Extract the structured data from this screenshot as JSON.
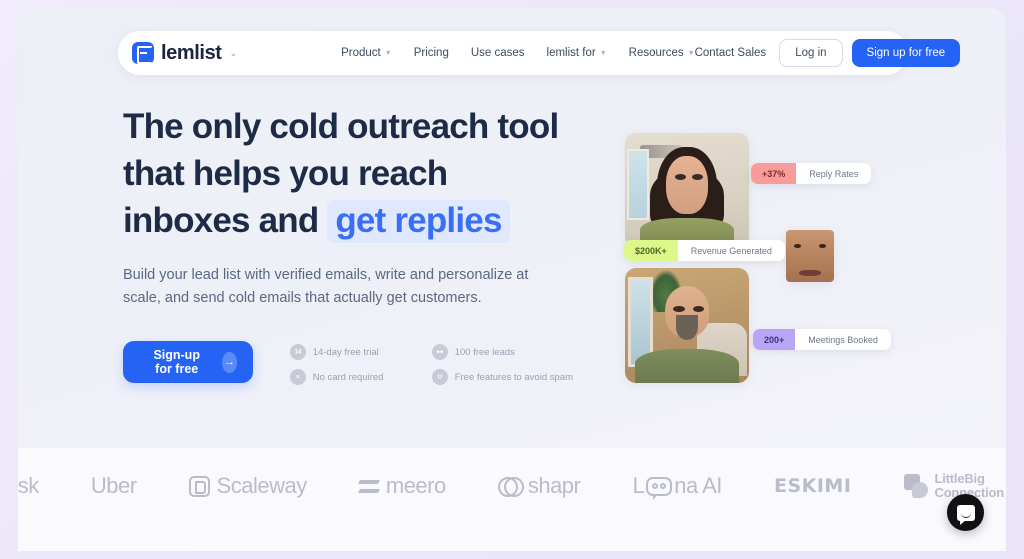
{
  "nav": {
    "brand": "lemlist",
    "brand_caret": "⌄",
    "links": [
      {
        "label": "Product",
        "has_caret": true
      },
      {
        "label": "Pricing",
        "has_caret": false
      },
      {
        "label": "Use cases",
        "has_caret": false
      },
      {
        "label": "lemlist for",
        "has_caret": true
      },
      {
        "label": "Resources",
        "has_caret": true
      }
    ],
    "contact_sales": "Contact Sales",
    "login": "Log in",
    "signup": "Sign up for free"
  },
  "hero": {
    "headline_part1": "The only cold outreach tool that helps you reach inboxes and ",
    "headline_accent": "get replies",
    "subhead": "Build your lead list with verified emails, write and personalize at scale, and send cold emails that actually get customers.",
    "cta_label": "Sign-up for free",
    "cta_arrow": "→",
    "features": [
      {
        "label": "14-day free trial",
        "icon": "calendar-icon",
        "glyph": "14"
      },
      {
        "label": "100 free leads",
        "icon": "users-icon",
        "glyph": "●●"
      },
      {
        "label": "No card required",
        "icon": "card-icon",
        "glyph": "≡"
      },
      {
        "label": "Free features to avoid spam",
        "icon": "shield-icon",
        "glyph": "U"
      }
    ]
  },
  "badges": [
    {
      "value": "+37%",
      "label": "Reply Rates",
      "value_bg": "#f79b9b",
      "value_color": "#7d2b2b"
    },
    {
      "value": "$200K+",
      "label": "Revenue Generated",
      "value_bg": "#ddf88a",
      "value_color": "#51651f"
    },
    {
      "value": "200+",
      "label": "Meetings Booked",
      "value_bg": "#b6a6f5",
      "value_color": "#3d2f80"
    }
  ],
  "logos": [
    {
      "name": "zendesk",
      "text": "esk",
      "mark": "none"
    },
    {
      "name": "uber",
      "text": "Uber",
      "mark": "none"
    },
    {
      "name": "scaleway",
      "text": "Scaleway",
      "mark": "square"
    },
    {
      "name": "meero",
      "text": "meero",
      "mark": "meero"
    },
    {
      "name": "shapr",
      "text": "shapr",
      "mark": "shapr"
    },
    {
      "name": "leena-ai",
      "text": "na AI",
      "text_pre": "L",
      "mark": "leena"
    },
    {
      "name": "eskimi",
      "text": "ESKIMI",
      "mark": "none"
    },
    {
      "name": "littlebig-connection",
      "text_line1": "LittleBig",
      "text_line2": "Connection",
      "mark": "lbc"
    }
  ],
  "colors": {
    "accent_blue": "#2563f5",
    "headline": "#1e2b46",
    "highlight_bg": "#dfe8fe",
    "page_bg": "#eceff6",
    "strip_bg": "#faf9fd"
  }
}
